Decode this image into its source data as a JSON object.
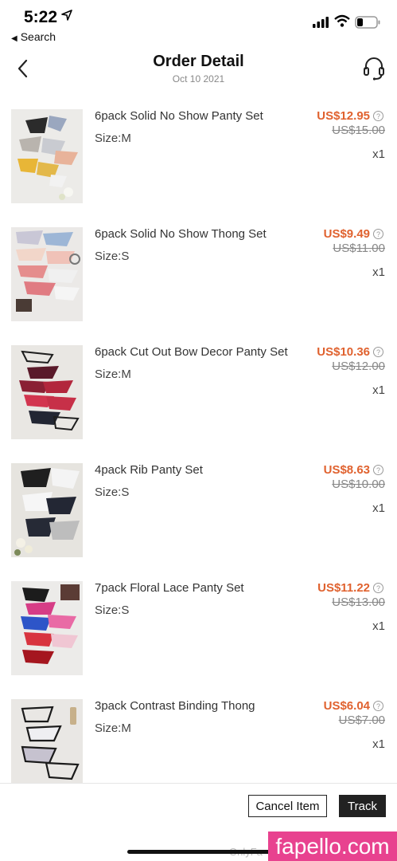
{
  "status_bar": {
    "time": "5:22",
    "back_app": "Search"
  },
  "header": {
    "title": "Order Detail",
    "date": "Oct 10 2021"
  },
  "items": [
    {
      "name": "6pack Solid No Show Panty Set",
      "size": "Size:M",
      "price": "US$12.95",
      "original_price": "US$15.00",
      "qty": "x1"
    },
    {
      "name": "6pack Solid No Show Thong Set",
      "size": "Size:S",
      "price": "US$9.49",
      "original_price": "US$11.00",
      "qty": "x1"
    },
    {
      "name": "6pack Cut Out Bow Decor Panty Set",
      "size": "Size:M",
      "price": "US$10.36",
      "original_price": "US$12.00",
      "qty": "x1"
    },
    {
      "name": "4pack Rib Panty Set",
      "size": "Size:S",
      "price": "US$8.63",
      "original_price": "US$10.00",
      "qty": "x1"
    },
    {
      "name": "7pack Floral Lace Panty Set",
      "size": "Size:S",
      "price": "US$11.22",
      "original_price": "US$13.00",
      "qty": "x1"
    },
    {
      "name": "3pack Contrast Binding Thong",
      "size": "Size:M",
      "price": "US$6.04",
      "original_price": "US$7.00",
      "qty": "x1"
    }
  ],
  "footer": {
    "cancel_label": "Cancel Item",
    "track_label": "Track",
    "watermark_small": "OnlyFa",
    "watermark": "fapello.com"
  },
  "colors": {
    "price": "#e0622f",
    "track_button": "#222222",
    "watermark": "#e8428f"
  }
}
